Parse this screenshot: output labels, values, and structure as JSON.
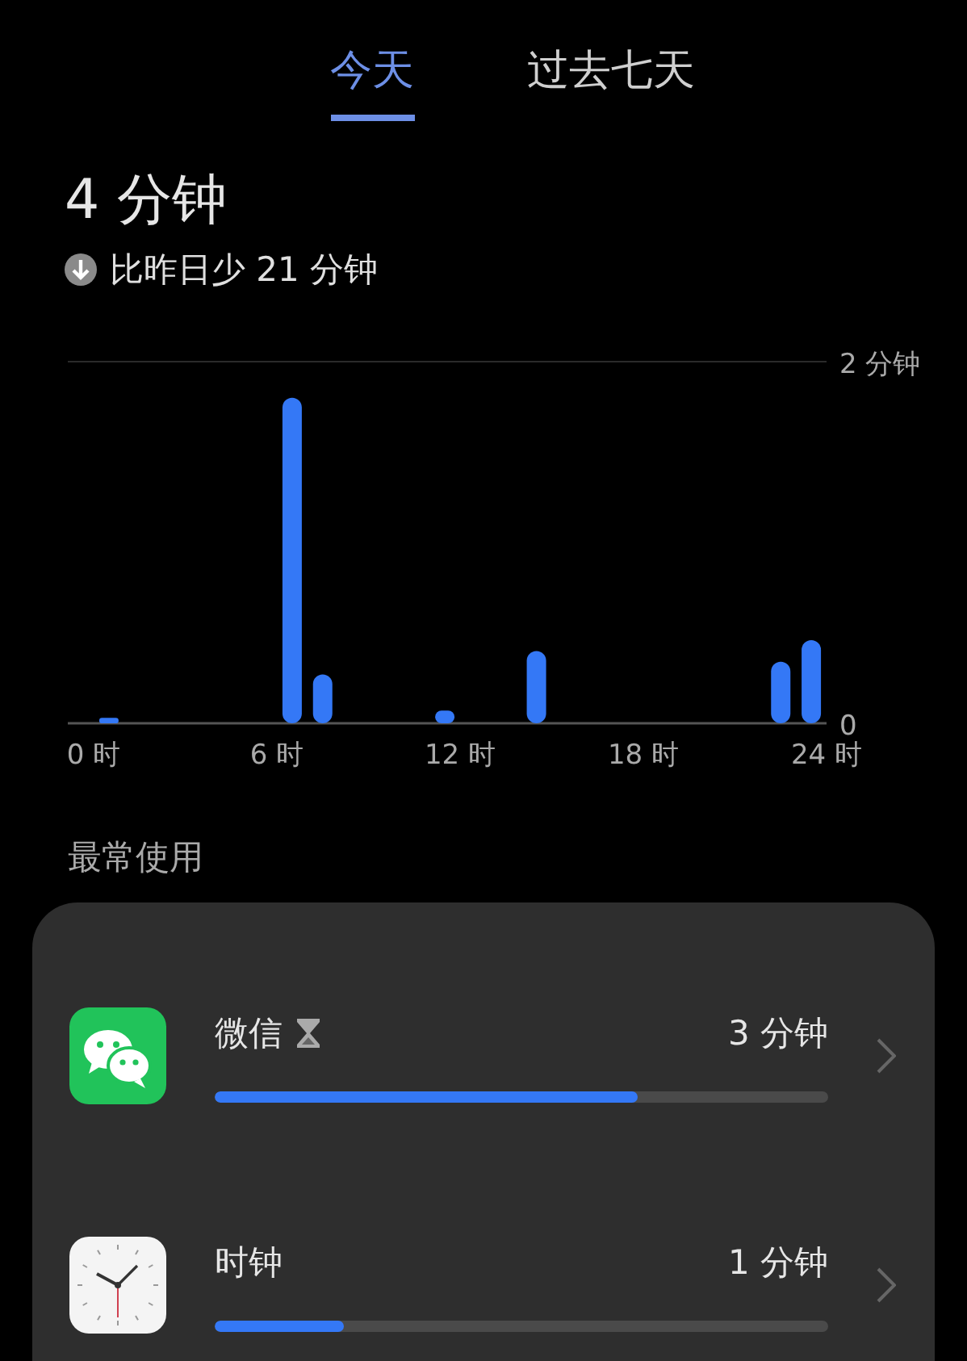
{
  "tabs": [
    {
      "label": "今天",
      "selected": true
    },
    {
      "label": "过去七天",
      "selected": false
    }
  ],
  "total": "4 分钟",
  "comparison": "比昨日少 21 分钟",
  "chart_data": {
    "type": "bar",
    "x": [
      0.5,
      6.5,
      7.5,
      11.5,
      14.5,
      22.5,
      23.5
    ],
    "xlim": [
      0,
      24
    ],
    "series": [
      {
        "color": "#3478f6",
        "values": [
          0.03,
          1.8,
          0.27,
          0.07,
          0.4,
          0.34,
          0.46
        ]
      }
    ],
    "ylim": [
      0,
      2
    ],
    "yticks": [
      {
        "value": 0,
        "label": "0"
      },
      {
        "value": 2,
        "label": "2 分钟"
      }
    ],
    "xticks": [
      {
        "value": 0,
        "label": "0 时"
      },
      {
        "value": 6,
        "label": "6 时"
      },
      {
        "value": 12,
        "label": "12 时"
      },
      {
        "value": 18,
        "label": "18 时"
      },
      {
        "value": 24,
        "label": "24 时"
      }
    ]
  },
  "section_title": "最常使用",
  "apps": [
    {
      "name": "微信",
      "kind": "chat",
      "time_limit": true,
      "time": "3 分钟",
      "level": 0.69
    },
    {
      "name": "时钟",
      "kind": "clock",
      "time_limit": false,
      "time": "1 分钟",
      "level": 0.21
    }
  ]
}
